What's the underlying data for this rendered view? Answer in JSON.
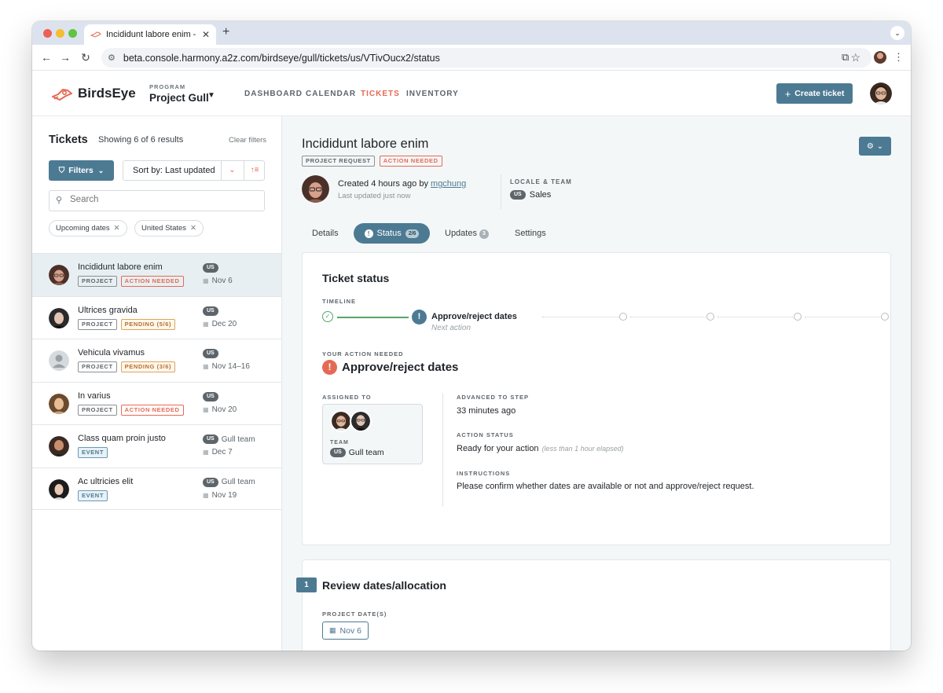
{
  "browser": {
    "tab_title": "Incididunt labore enim - Birds",
    "url": "beta.console.harmony.a2z.com/birdseye/gull/tickets/us/VTivOucx2/status"
  },
  "header": {
    "brand": "BirdsEye",
    "program_label": "PROGRAM",
    "program_name": "Project Gull",
    "nav": [
      "DASHBOARD",
      "CALENDAR",
      "TICKETS",
      "INVENTORY"
    ],
    "active_nav": "TICKETS",
    "create_label": "Create ticket"
  },
  "sidebar": {
    "title": "Tickets",
    "showing": "Showing 6 of 6 results",
    "clear_filters": "Clear filters",
    "filters_label": "Filters",
    "sort_label": "Sort by: Last updated",
    "search_placeholder": "Search",
    "chips": [
      "Upcoming dates",
      "United States"
    ],
    "tickets": [
      {
        "name": "Incididunt labore enim",
        "tags": [
          {
            "text": "PROJECT",
            "kind": "default"
          },
          {
            "text": "ACTION NEEDED",
            "kind": "danger"
          }
        ],
        "locale": "US",
        "team": "",
        "date": "Nov 6",
        "selected": true
      },
      {
        "name": "Ultrices gravida",
        "tags": [
          {
            "text": "PROJECT",
            "kind": "default"
          },
          {
            "text": "PENDING (5/6)",
            "kind": "pending"
          }
        ],
        "locale": "US",
        "team": "",
        "date": "Dec 20"
      },
      {
        "name": "Vehicula vivamus",
        "tags": [
          {
            "text": "PROJECT",
            "kind": "default"
          },
          {
            "text": "PENDING (3/6)",
            "kind": "pending"
          }
        ],
        "locale": "US",
        "team": "",
        "date": "Nov 14–16"
      },
      {
        "name": "In varius",
        "tags": [
          {
            "text": "PROJECT",
            "kind": "default"
          },
          {
            "text": "ACTION NEEDED",
            "kind": "danger"
          }
        ],
        "locale": "US",
        "team": "",
        "date": "Nov 20"
      },
      {
        "name": "Class quam proin justo",
        "tags": [
          {
            "text": "EVENT",
            "kind": "event"
          }
        ],
        "locale": "US",
        "team": "Gull team",
        "date": "Dec 7"
      },
      {
        "name": "Ac ultricies elit",
        "tags": [
          {
            "text": "EVENT",
            "kind": "event"
          }
        ],
        "locale": "US",
        "team": "Gull team",
        "date": "Nov 19"
      }
    ]
  },
  "ticket": {
    "title": "Incididunt labore enim",
    "tags": [
      "PROJECT REQUEST",
      "ACTION NEEDED"
    ],
    "created_prefix": "Created 4 hours ago by ",
    "created_by": "mgchung",
    "last_updated": "Last updated just now",
    "locale_label": "LOCALE & TEAM",
    "locale": "US",
    "team": "Sales",
    "tabs": {
      "details": "Details",
      "status": "Status",
      "status_count": "2/6",
      "updates": "Updates",
      "updates_count": "3",
      "settings": "Settings"
    }
  },
  "status_card": {
    "title": "Ticket status",
    "timeline_label": "TIMELINE",
    "current_step": "Approve/reject dates",
    "next_action": "Next action",
    "action_needed_label": "YOUR ACTION NEEDED",
    "action_title": "Approve/reject dates",
    "assigned_label": "ASSIGNED TO",
    "team_label": "TEAM",
    "team_locale": "US",
    "team_name": "Gull team",
    "advanced_label": "ADVANCED TO STEP",
    "advanced_value": "33 minutes ago",
    "action_status_label": "ACTION STATUS",
    "action_status_value": "Ready for your action",
    "action_status_note": "(less than 1 hour elapsed)",
    "instructions_label": "INSTRUCTIONS",
    "instructions_value": "Please confirm whether dates are available or not and approve/reject request."
  },
  "review_card": {
    "step_number": "1",
    "title": "Review dates/allocation",
    "dates_label": "PROJECT DATE(S)",
    "date_value": "Nov 6"
  },
  "colors": {
    "accent": "#4d7a93",
    "danger": "#e56a54",
    "success": "#5aa469",
    "pending": "#e1a35a"
  }
}
